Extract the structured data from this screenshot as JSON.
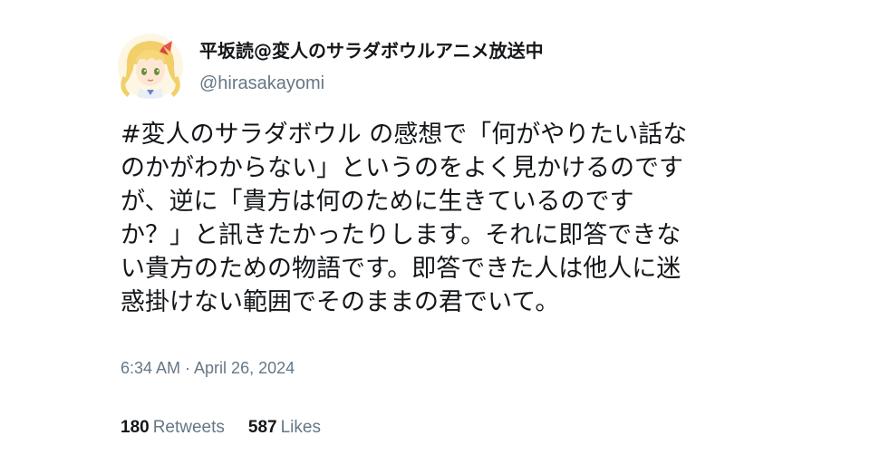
{
  "tweet": {
    "display_name": "平坂読@変人のサラダボウルアニメ放送中",
    "handle": "@hirasakayomi",
    "text": "#変人のサラダボウル の感想で「何がやりたい話な\nのかがわからない」というのをよく見かけるのです\nが、逆に「貴方は何のために生きているのです\nか？」と訊きたかったりします。それに即答できな\nい貴方のための物語です。即答できた人は他人に迷\n惑掛けない範囲でそのままの君でいて。",
    "timestamp": "6:34 AM · April 26, 2024",
    "stats": {
      "retweets_count": "180",
      "retweets_label": "Retweets",
      "likes_count": "587",
      "likes_label": "Likes"
    }
  },
  "colors": {
    "text_primary": "#14171a",
    "text_secondary": "#657786",
    "background": "#ffffff"
  },
  "icons": {
    "avatar": "anime-character-avatar"
  }
}
